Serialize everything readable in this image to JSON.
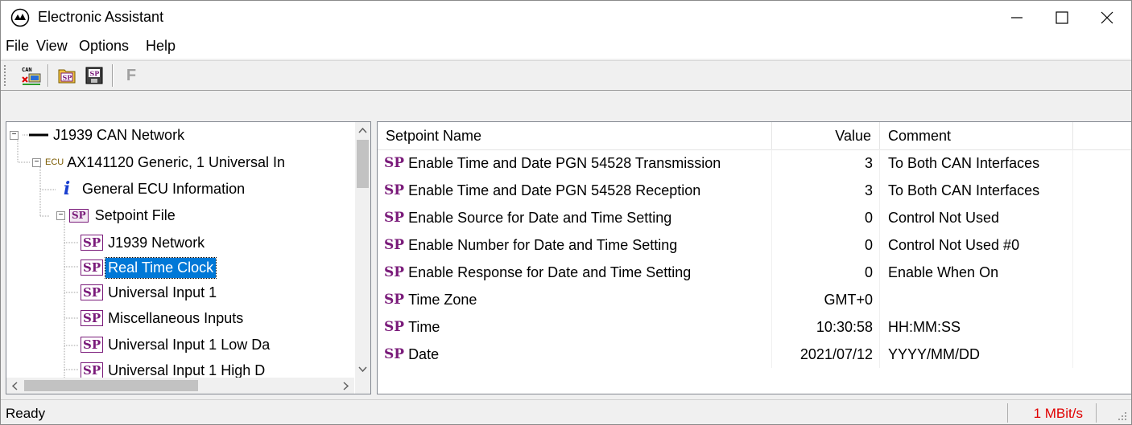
{
  "window": {
    "title": "Electronic Assistant"
  },
  "menu": [
    "File",
    "View",
    "Options",
    "Help"
  ],
  "toolbar": {
    "can_label": "CAN",
    "sp_label": "SP",
    "f_label": "F"
  },
  "tree": {
    "network": "J1939 CAN Network",
    "ecu_prefix": "ECU",
    "ecu": "AX141120 Generic, 1 Universal In",
    "general_info_icon": "i",
    "general_info": "General ECU Information",
    "setpoint_file": "Setpoint File",
    "sp_icon": "SP",
    "items": [
      "J1939 Network",
      "Real Time Clock",
      "Universal Input 1",
      "Miscellaneous Inputs",
      "Universal Input 1 Low Da",
      "Universal Input 1 High D"
    ],
    "selected": "Real Time Clock"
  },
  "table": {
    "headers": {
      "name": "Setpoint Name",
      "value": "Value",
      "comment": "Comment"
    },
    "sp_prefix": "SP",
    "rows": [
      {
        "name": "Enable Time and Date PGN 54528 Transmission",
        "value": "3",
        "comment": "To Both CAN Interfaces"
      },
      {
        "name": "Enable Time and Date PGN 54528 Reception",
        "value": "3",
        "comment": "To Both CAN Interfaces"
      },
      {
        "name": "Enable Source for Date and Time Setting",
        "value": "0",
        "comment": "Control Not Used"
      },
      {
        "name": "Enable Number for Date and Time Setting",
        "value": "0",
        "comment": "Control Not Used #0"
      },
      {
        "name": "Enable Response for Date and Time Setting",
        "value": "0",
        "comment": "Enable When On"
      },
      {
        "name": "Time Zone",
        "value": "GMT+0",
        "comment": ""
      },
      {
        "name": "Time",
        "value": "10:30:58",
        "comment": "HH:MM:SS"
      },
      {
        "name": "Date",
        "value": "2021/07/12",
        "comment": "YYYY/MM/DD"
      }
    ]
  },
  "status": {
    "left": "Ready",
    "speed": "1 MBit/s"
  },
  "colors": {
    "selection": "#0078d7",
    "sp_purple": "#7a1b7a",
    "speed_red": "#e00000"
  }
}
